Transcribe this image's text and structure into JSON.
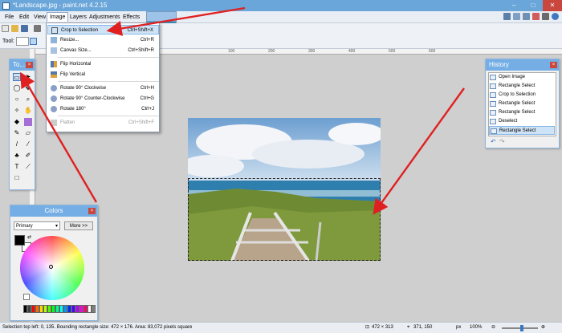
{
  "window": {
    "title": "*Landscape.jpg - paint.net 4.2.15",
    "controls": [
      "–",
      "□",
      "✕"
    ]
  },
  "menubar": {
    "items": [
      "File",
      "Edit",
      "View",
      "Image",
      "Layers",
      "Adjustments",
      "Effects"
    ],
    "active": "Image"
  },
  "toolbar": {
    "tool_label": "Tool:"
  },
  "rulers": {
    "top_ticks": [
      "100",
      "200",
      "300",
      "400",
      "500",
      "600"
    ]
  },
  "image_menu": {
    "items": [
      {
        "label": "Crop to Selection",
        "shortcut": "Ctrl+Shift+X",
        "icon": "crop-icon",
        "highlighted": true
      },
      {
        "label": "Resize...",
        "shortcut": "Ctrl+R",
        "icon": "resize-icon"
      },
      {
        "label": "Canvas Size...",
        "shortcut": "Ctrl+Shift+R",
        "icon": "canvas-size-icon"
      },
      {
        "separator": true
      },
      {
        "label": "Flip Horizontal",
        "shortcut": "",
        "icon": "flip-horizontal-icon"
      },
      {
        "label": "Flip Vertical",
        "shortcut": "",
        "icon": "flip-vertical-icon"
      },
      {
        "separator": true
      },
      {
        "label": "Rotate 90° Clockwise",
        "shortcut": "Ctrl+H",
        "icon": "rotate-cw-icon"
      },
      {
        "label": "Rotate 90° Counter-Clockwise",
        "shortcut": "Ctrl+G",
        "icon": "rotate-ccw-icon"
      },
      {
        "label": "Rotate 180°",
        "shortcut": "Ctrl+J",
        "icon": "rotate-180-icon"
      },
      {
        "separator": true
      },
      {
        "label": "Flatten",
        "shortcut": "Ctrl+Shift+F",
        "icon": "flatten-icon",
        "disabled": true
      }
    ]
  },
  "tools_panel": {
    "title": "To...",
    "close": "×"
  },
  "history_panel": {
    "title": "History",
    "close": "×",
    "items": [
      "Open Image",
      "Rectangle Select",
      "Crop to Selection",
      "Rectangle Select",
      "Rectangle Select",
      "Deselect",
      "Rectangle Select"
    ],
    "selected_index": 6
  },
  "colors_panel": {
    "title": "Colors",
    "close": "×",
    "mode": "Primary",
    "more_button": "More >>",
    "primary_color": "#000000",
    "secondary_color": "#ffffff"
  },
  "statusbar": {
    "text": "Selection top left: 0, 135. Bounding rectangle size: 472 × 176. Area: 83,072 pixels square",
    "image_size": "472 × 313",
    "cursor_pos": "371, 150",
    "units": "px",
    "zoom": "100%"
  },
  "palette": [
    "#000000",
    "#404040",
    "#ff0000",
    "#ff6a00",
    "#ffd800",
    "#b6ff00",
    "#4cff00",
    "#00ff21",
    "#00ff90",
    "#00ffff",
    "#0094ff",
    "#0026ff",
    "#4800ff",
    "#b200ff",
    "#ff00dc",
    "#ff006e",
    "#ffffff",
    "#808080"
  ]
}
